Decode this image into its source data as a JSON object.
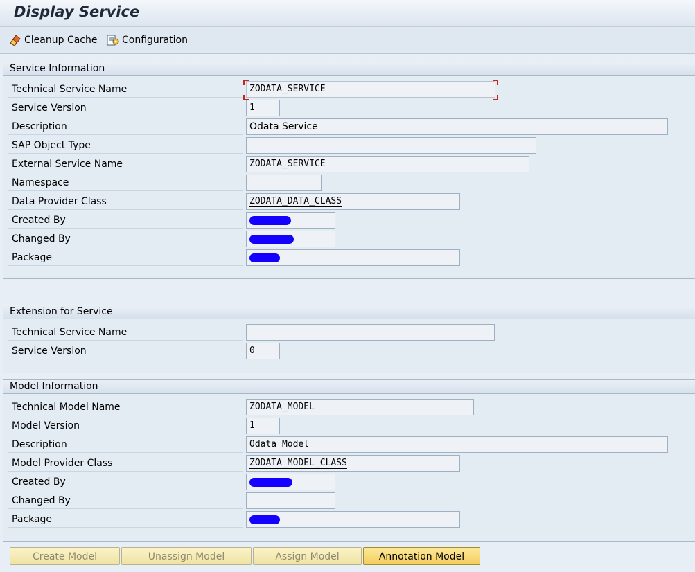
{
  "window": {
    "title": "Display Service"
  },
  "toolbar": {
    "cleanup_label": "Cleanup Cache",
    "configuration_label": "Configuration"
  },
  "service_info": {
    "header": "Service Information",
    "rows": [
      {
        "label": "Technical Service Name",
        "value": "ZODATA_SERVICE"
      },
      {
        "label": "Service Version",
        "value": "1"
      },
      {
        "label": "Description",
        "value": "Odata Service"
      },
      {
        "label": "SAP Object Type",
        "value": ""
      },
      {
        "label": "External Service Name",
        "value": "ZODATA_SERVICE"
      },
      {
        "label": "Namespace",
        "value": ""
      },
      {
        "label": "Data Provider Class",
        "value": "ZODATA_DATA_CLASS"
      },
      {
        "label": "Created By",
        "value": ""
      },
      {
        "label": "Changed By",
        "value": ""
      },
      {
        "label": "Package",
        "value": ""
      }
    ]
  },
  "extension": {
    "header": "Extension for Service",
    "rows": [
      {
        "label": "Technical Service Name",
        "value": ""
      },
      {
        "label": "Service Version",
        "value": "0"
      }
    ]
  },
  "model_info": {
    "header": "Model Information",
    "rows": [
      {
        "label": "Technical Model Name",
        "value": "ZODATA_MODEL"
      },
      {
        "label": "Model Version",
        "value": "1"
      },
      {
        "label": "Description",
        "value": "Odata Model"
      },
      {
        "label": "Model Provider Class",
        "value": "ZODATA_MODEL_CLASS"
      },
      {
        "label": "Created By",
        "value": ""
      },
      {
        "label": "Changed By",
        "value": ""
      },
      {
        "label": "Package",
        "value": ""
      }
    ]
  },
  "buttons": {
    "create_model": "Create Model",
    "unassign_model": "Unassign Model",
    "assign_model": "Assign Model",
    "annotation_model": "Annotation Model"
  },
  "colors": {
    "redaction": "#1400ff",
    "focus_bracket": "#c0271d",
    "active_button": "#f3cd5d"
  }
}
